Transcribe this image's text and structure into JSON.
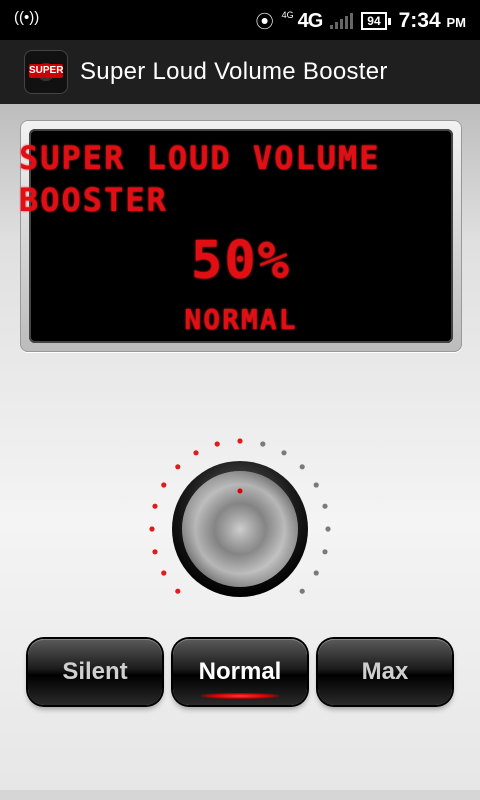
{
  "status_bar": {
    "left_icon": "wifi-hotspot-icon",
    "network_small": "4G",
    "network": "4G",
    "battery": "94",
    "time": "7:34",
    "ampm": "PM"
  },
  "action_bar": {
    "title": "Super Loud Volume Booster",
    "icon_label": "SUPER"
  },
  "display": {
    "title": "SUPER LOUD VOLUME BOOSTER",
    "percent": "50%",
    "mode": "NORMAL"
  },
  "knob": {
    "level": 0.5,
    "active_color": "#e11b1b",
    "inactive_color": "#7a7a7a"
  },
  "buttons": [
    {
      "label": "Silent",
      "active": false
    },
    {
      "label": "Normal",
      "active": true
    },
    {
      "label": "Max",
      "active": false
    }
  ],
  "colors": {
    "lcd_red": "#e10f14"
  }
}
